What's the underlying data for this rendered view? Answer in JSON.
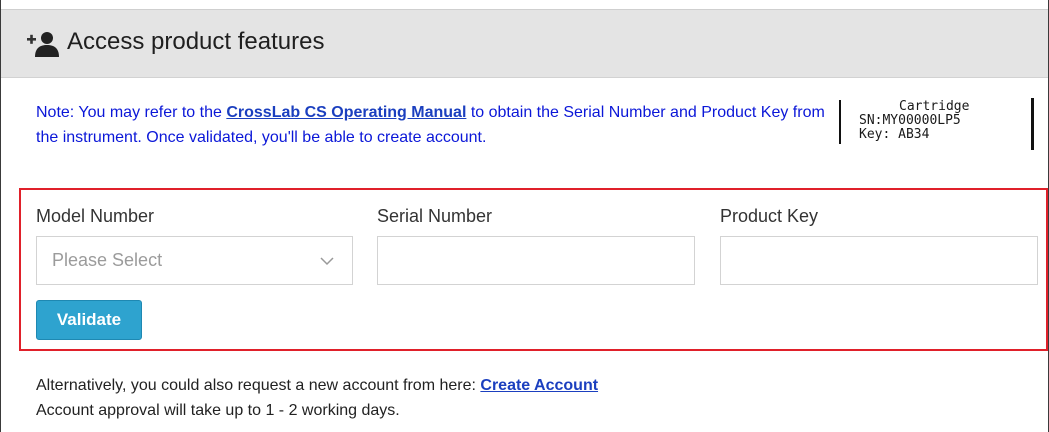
{
  "header": {
    "icon": "add-user-icon",
    "title": "Access product features"
  },
  "note": {
    "before_link": "Note: You may refer to the ",
    "link_text": "CrossLab CS Operating Manual",
    "after_link": " to obtain the Serial Number and Product Key from the instrument. Once validated, you'll be able to create account."
  },
  "cartridge": {
    "line1": "Cartridge",
    "line2": "SN:MY00000LP5",
    "line3": "Key: AB34"
  },
  "form": {
    "model_label": "Model Number",
    "model_placeholder": "Please Select",
    "serial_label": "Serial Number",
    "serial_value": "",
    "product_key_label": "Product Key",
    "product_key_value": "",
    "validate_label": "Validate"
  },
  "alternative": {
    "line1_text": "Alternatively, you could also request a new account from here: ",
    "create_account_link": "Create Account",
    "line2_text": "Account approval will take up to 1 - 2 working days."
  },
  "colors": {
    "note_text": "#0b17d8",
    "link": "#1b3fbf",
    "highlight_border": "#e0202a",
    "button": "#2ea3cf",
    "header_bg": "#e4e4e4"
  }
}
